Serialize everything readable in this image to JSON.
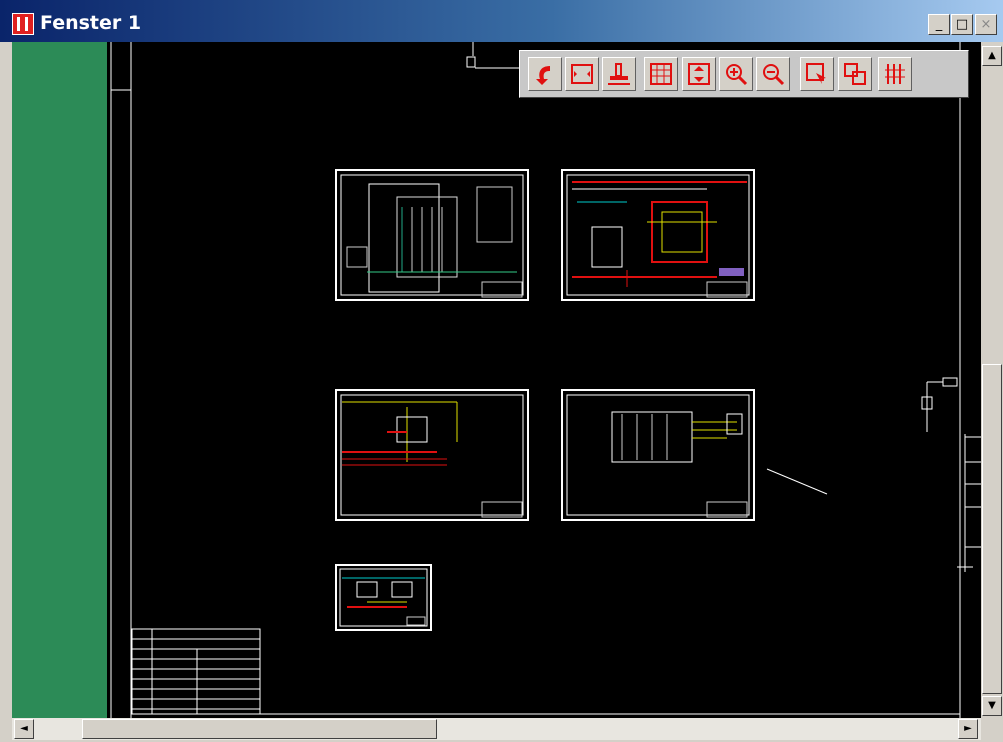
{
  "window": {
    "title": "Fenster 1"
  },
  "window_controls": {
    "minimize": "_",
    "maximize": "□",
    "close": "×"
  },
  "toolbar": {
    "buttons": [
      {
        "name": "undo-arrow-icon"
      },
      {
        "name": "fit-window-icon"
      },
      {
        "name": "pan-icon"
      },
      {
        "name": "grid-view-icon"
      },
      {
        "name": "zoom-extents-icon"
      },
      {
        "name": "zoom-in-icon"
      },
      {
        "name": "zoom-out-icon"
      },
      {
        "name": "zoom-window-icon"
      },
      {
        "name": "overview-icon"
      },
      {
        "name": "columns-icon"
      }
    ]
  },
  "scrollbars": {
    "up": "▲",
    "down": "▼",
    "left": "◄",
    "right": "►"
  },
  "colors": {
    "sidebar": "#2c8b57",
    "canvas": "#000000",
    "drawing_lines": "#ffffff",
    "accent_red": "#e01010",
    "accent_yellow": "#e0e000"
  }
}
